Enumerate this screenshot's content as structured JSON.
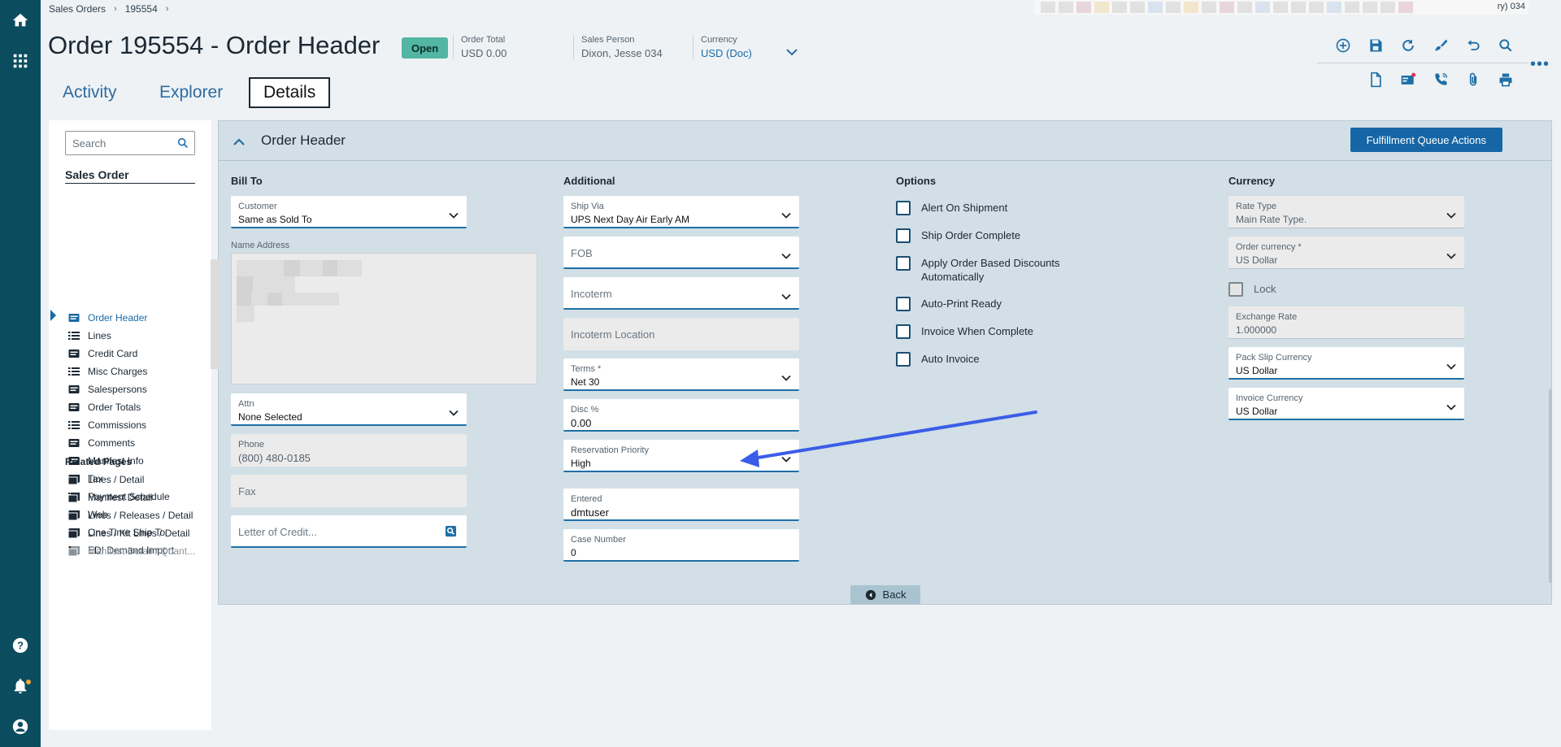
{
  "breadcrumb": [
    "Sales Orders",
    "195554"
  ],
  "top_strip_tail": "ry) 034",
  "header": {
    "title": "Order 195554 - Order Header",
    "status": "Open",
    "order_total": {
      "label": "Order Total",
      "value": "USD  0.00"
    },
    "sales_person": {
      "label": "Sales Person",
      "value": "Dixon, Jesse 034"
    },
    "currency": {
      "label": "Currency",
      "value": "USD (Doc)"
    }
  },
  "toolbar_row1": [
    "add-icon",
    "save-icon",
    "refresh-icon",
    "clear-icon",
    "undo-icon",
    "search-icon"
  ],
  "toolbar_row2": [
    "document-icon",
    "card-icon",
    "phone-icon",
    "paperclip-icon",
    "print-icon"
  ],
  "tabs": [
    {
      "label": "Activity",
      "active": false
    },
    {
      "label": "Explorer",
      "active": false
    },
    {
      "label": "Details",
      "active": true
    }
  ],
  "sidenav": {
    "search_placeholder": "Search",
    "section": "Sales Order",
    "items": [
      {
        "label": "Order Header",
        "icon": "card-icon",
        "active": true
      },
      {
        "label": "Lines",
        "icon": "list-icon"
      },
      {
        "label": "Credit Card",
        "icon": "card-icon"
      },
      {
        "label": "Misc Charges",
        "icon": "list-icon"
      },
      {
        "label": "Salespersons",
        "icon": "card-icon"
      },
      {
        "label": "Order Totals",
        "icon": "card-icon"
      },
      {
        "label": "Commissions",
        "icon": "list-icon"
      },
      {
        "label": "Comments",
        "icon": "card-icon"
      },
      {
        "label": "Manifest Info",
        "icon": "card-icon"
      },
      {
        "label": "Tax",
        "icon": "card-icon"
      },
      {
        "label": "Payment Schedule",
        "icon": "list-icon"
      },
      {
        "label": "Web",
        "icon": "card-icon"
      },
      {
        "label": "One Time Ship To",
        "icon": "card-icon"
      },
      {
        "label": "EDI Demand Import",
        "icon": "card-icon"
      }
    ],
    "related_title": "Related Pages",
    "related": [
      {
        "label": "Lines / Detail"
      },
      {
        "label": "Manifest Detail"
      },
      {
        "label": "Lines / Releases / Detail"
      },
      {
        "label": "Lines / Kit Lines / Detail"
      },
      {
        "label": "Manifest Detail / Quant...",
        "disabled": true
      }
    ]
  },
  "panel": {
    "title": "Order Header",
    "action_button": "Fulfillment Queue Actions",
    "bill_to": {
      "heading": "Bill To",
      "customer": {
        "label": "Customer",
        "value": "Same as Sold To"
      },
      "name_address_label": "Name Address",
      "attn": {
        "label": "Attn",
        "value": "None Selected"
      },
      "phone": {
        "label": "Phone",
        "value": "(800) 480-0185"
      },
      "fax": {
        "placeholder": "Fax"
      },
      "letter_of_credit": {
        "placeholder": "Letter of Credit..."
      }
    },
    "additional": {
      "heading": "Additional",
      "ship_via": {
        "label": "Ship Via",
        "value": "UPS Next Day Air Early AM"
      },
      "fob": {
        "placeholder": "FOB"
      },
      "incoterm": {
        "placeholder": "Incoterm"
      },
      "incoterm_location": {
        "placeholder": "Incoterm Location"
      },
      "terms": {
        "label": "Terms *",
        "value": "Net 30"
      },
      "disc": {
        "label": "Disc %",
        "value": "0.00"
      },
      "reservation_priority": {
        "label": "Reservation Priority",
        "value": "High"
      },
      "entered": {
        "label": "Entered",
        "value": "dmtuser"
      },
      "case_number": {
        "label": "Case Number",
        "value": "0"
      }
    },
    "options": {
      "heading": "Options",
      "items": [
        {
          "label": "Alert On Shipment",
          "checked": false
        },
        {
          "label": "Ship Order Complete",
          "checked": false
        },
        {
          "label": "Apply Order Based Discounts Automatically",
          "checked": false
        },
        {
          "label": "Auto-Print Ready",
          "checked": false
        },
        {
          "label": "Invoice When Complete",
          "checked": false
        },
        {
          "label": "Auto Invoice",
          "checked": false
        }
      ]
    },
    "currency": {
      "heading": "Currency",
      "rate_type": {
        "label": "Rate Type",
        "value": "Main Rate Type."
      },
      "order_currency": {
        "label": "Order currency *",
        "value": "US Dollar"
      },
      "lock": {
        "label": "Lock",
        "checked": false
      },
      "exchange_rate": {
        "label": "Exchange Rate",
        "value": "1.000000"
      },
      "pack_slip_currency": {
        "label": "Pack Slip Currency",
        "value": "US Dollar"
      },
      "invoice_currency": {
        "label": "Invoice Currency",
        "value": "US Dollar"
      }
    },
    "back_button": "Back"
  },
  "colors": {
    "rail": "#0b4d5e",
    "accent": "#1f6fa6",
    "status_badge": "#53b5a3",
    "panel_bg": "#d2dfe6",
    "annotation_arrow": "#3a5de8"
  }
}
